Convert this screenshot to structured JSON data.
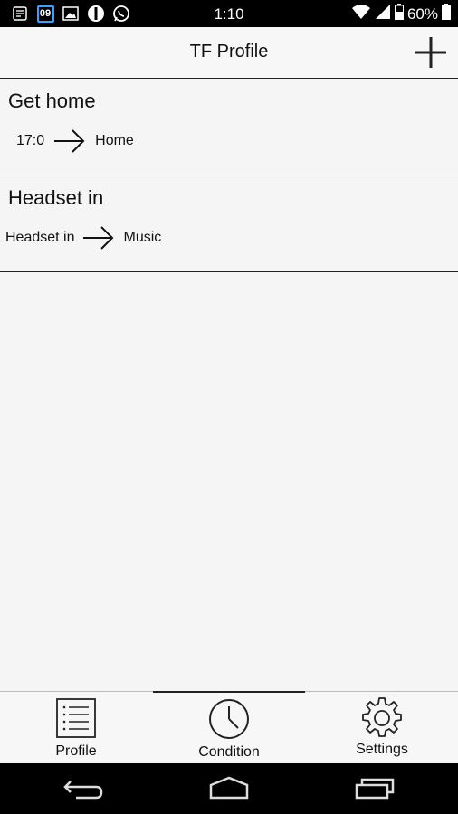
{
  "status_bar": {
    "calendar_day": "09",
    "time": "1:10",
    "battery": "60%",
    "icons": [
      "notification-icon",
      "calendar-icon",
      "image-icon",
      "app-icon",
      "whatsapp-icon",
      "wifi-icon",
      "signal-icon",
      "battery-icon"
    ]
  },
  "app_bar": {
    "title": "TF Profile",
    "add_icon": "plus-icon"
  },
  "profiles": [
    {
      "title": "Get home",
      "condition": "17:0",
      "action": "Home"
    },
    {
      "title": "Headset in",
      "condition": "Headset in",
      "action": "Music"
    }
  ],
  "tabs": [
    {
      "label": "Profile",
      "icon": "list-icon",
      "active": false
    },
    {
      "label": "Condition",
      "icon": "clock-icon",
      "active": true
    },
    {
      "label": "Settings",
      "icon": "gear-icon",
      "active": false
    }
  ],
  "nav_bar": {
    "icons": [
      "back-icon",
      "home-icon",
      "recents-icon"
    ]
  }
}
